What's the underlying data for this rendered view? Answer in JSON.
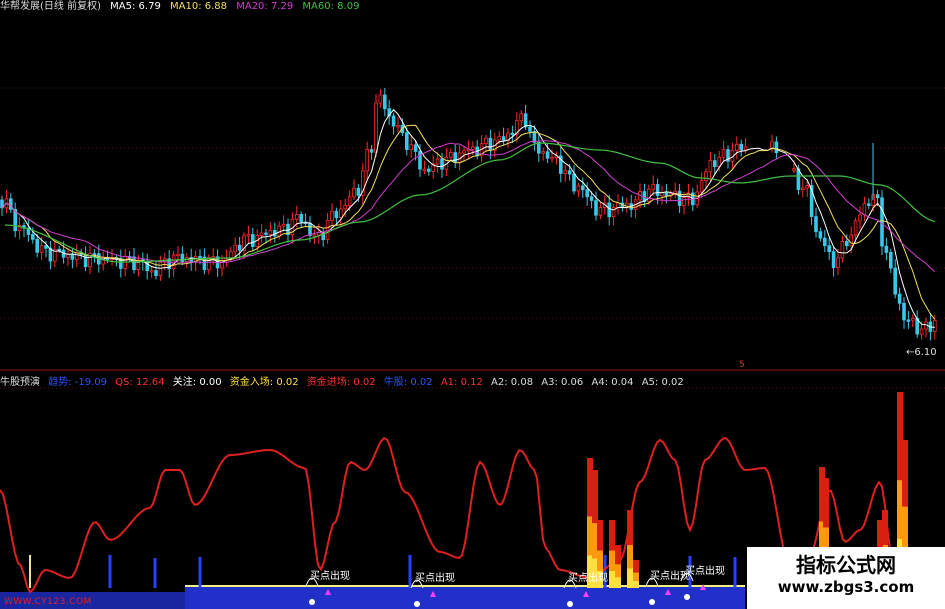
{
  "top_legend": {
    "name": "华帮发展(日线 前复权)",
    "ma5": "MA5: 6.79",
    "ma10": "MA10: 6.88",
    "ma20": "MA20: 7.29",
    "ma60": "MA60: 8.09"
  },
  "price_label": "6.10",
  "panel_marker": "5",
  "indicator_legend": {
    "name": "牛股预演",
    "v1": "趋势: -19.09",
    "v2": "QS: 12.64",
    "v3": "关注: 0.00",
    "v4": "资金入场: 0.02",
    "v5": "资金进场: 0.02",
    "v6": "牛股: 0.02",
    "a1": "A1: 0.12",
    "a2": "A2: 0.08",
    "a3": "A3: 0.06",
    "a4": "A4: 0.04",
    "a5": "A5: 0.02"
  },
  "signals": [
    {
      "label": "买点出现"
    },
    {
      "label": "买点出现"
    },
    {
      "label": "买点出现"
    },
    {
      "label": "买点出现"
    },
    {
      "label": "买点出现"
    }
  ],
  "watermark_small": "WWW.CY123.COM",
  "brand": {
    "title": "指标公式网",
    "url": "www.zbgs3.com"
  },
  "colors": {
    "up": "#ff2a2a",
    "down": "#38c8e8",
    "ma5": "#ffffff",
    "ma10": "#f0e060",
    "ma20": "#d040d0",
    "ma60": "#40c040",
    "curve": "#dd2020",
    "baseline_fill": "#2030c8",
    "baseline_line": "#f0f080"
  }
}
